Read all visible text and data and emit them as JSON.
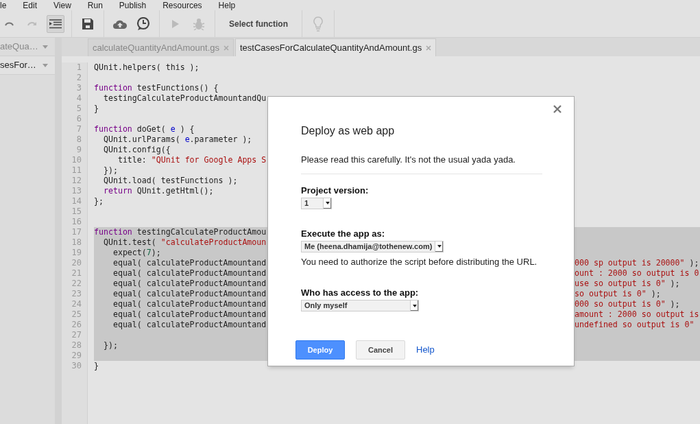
{
  "menu_bar": [
    "le",
    "Edit",
    "View",
    "Run",
    "Publish",
    "Resources",
    "Help"
  ],
  "toolbar": {
    "function_select": "Select function",
    "indent_pressed": true
  },
  "sidebar": {
    "files": [
      {
        "label": "ateQua…",
        "selected": false
      },
      {
        "label": "sesFor…",
        "selected": true
      }
    ]
  },
  "tabs": [
    {
      "label": "calculateQuantityAndAmount.gs",
      "selected": false
    },
    {
      "label": "testCasesForCalculateQuantityAndAmount.gs",
      "selected": true
    }
  ],
  "editor": {
    "lines": [
      {
        "number": "1",
        "selected": false,
        "left": [
          {
            "text": "QUnit.helpers( this );",
            "kind": "plain"
          }
        ]
      },
      {
        "number": "2",
        "selected": false
      },
      {
        "number": "3",
        "selected": false,
        "left": [
          {
            "text": "function",
            "kind": "keyword"
          },
          {
            "text": " testFunctions() {",
            "kind": "plain"
          }
        ]
      },
      {
        "number": "4",
        "selected": false,
        "left": [
          {
            "text": "  testingCalculateProductAmountandQu",
            "kind": "plain"
          }
        ]
      },
      {
        "number": "5",
        "selected": false,
        "left": [
          {
            "text": "}",
            "kind": "plain"
          }
        ]
      },
      {
        "number": "6",
        "selected": false
      },
      {
        "number": "7",
        "selected": false,
        "left": [
          {
            "text": "function",
            "kind": "keyword"
          },
          {
            "text": " doGet( ",
            "kind": "plain"
          },
          {
            "text": "e",
            "kind": "variable"
          },
          {
            "text": " ) {",
            "kind": "plain"
          }
        ]
      },
      {
        "number": "8",
        "selected": false,
        "left": [
          {
            "text": "  QUnit.urlParams( ",
            "kind": "plain"
          },
          {
            "text": "e",
            "kind": "variable"
          },
          {
            "text": ".parameter );",
            "kind": "plain"
          }
        ]
      },
      {
        "number": "9",
        "selected": false,
        "left": [
          {
            "text": "  QUnit.config({",
            "kind": "plain"
          }
        ]
      },
      {
        "number": "10",
        "selected": false,
        "left": [
          {
            "text": "     title: ",
            "kind": "plain"
          },
          {
            "text": "\"QUnit for Google Apps S",
            "kind": "string"
          }
        ]
      },
      {
        "number": "11",
        "selected": false,
        "left": [
          {
            "text": "  });",
            "kind": "plain"
          }
        ]
      },
      {
        "number": "12",
        "selected": false,
        "left": [
          {
            "text": "  QUnit.load( testFunctions );",
            "kind": "plain"
          }
        ]
      },
      {
        "number": "13",
        "selected": false,
        "left": [
          {
            "text": "  return",
            "kind": "keyword"
          },
          {
            "text": " QUnit.getHtml();",
            "kind": "plain"
          }
        ]
      },
      {
        "number": "14",
        "selected": false,
        "left": [
          {
            "text": "};",
            "kind": "plain"
          }
        ]
      },
      {
        "number": "15",
        "selected": false
      },
      {
        "number": "16",
        "selected": false
      },
      {
        "number": "17",
        "selected": true,
        "left": [
          {
            "text": "function",
            "kind": "keyword"
          },
          {
            "text": " testingCalculateProductAmou",
            "kind": "plain"
          }
        ]
      },
      {
        "number": "18",
        "selected": true,
        "left": [
          {
            "text": "  QUnit.test( ",
            "kind": "plain"
          },
          {
            "text": "\"calculateProductAmoun",
            "kind": "string"
          }
        ]
      },
      {
        "number": "19",
        "selected": true,
        "left": [
          {
            "text": "    expect(",
            "kind": "plain"
          },
          {
            "text": "7",
            "kind": "number"
          },
          {
            "text": ");",
            "kind": "plain"
          }
        ]
      },
      {
        "number": "20",
        "selected": true,
        "left": [
          {
            "text": "    equal( calculateProductAmountand",
            "kind": "plain"
          }
        ],
        "right": [
          {
            "text": "000 sp output is 20000\"",
            "kind": "string"
          },
          {
            "text": " );",
            "kind": "plain"
          }
        ]
      },
      {
        "number": "21",
        "selected": true,
        "left": [
          {
            "text": "    equal( calculateProductAmountand",
            "kind": "plain"
          }
        ],
        "right": [
          {
            "text": "ount : 2000 so output is 0",
            "kind": "string"
          }
        ]
      },
      {
        "number": "22",
        "selected": true,
        "left": [
          {
            "text": "    equal( calculateProductAmountand",
            "kind": "plain"
          }
        ],
        "right": [
          {
            "text": "use so output is 0\"",
            "kind": "string"
          },
          {
            "text": " );",
            "kind": "plain"
          }
        ]
      },
      {
        "number": "23",
        "selected": true,
        "left": [
          {
            "text": "    equal( calculateProductAmountand",
            "kind": "plain"
          }
        ],
        "right": [
          {
            "text": "so output is 0\"",
            "kind": "string"
          },
          {
            "text": " );",
            "kind": "plain"
          }
        ]
      },
      {
        "number": "24",
        "selected": true,
        "left": [
          {
            "text": "    equal( calculateProductAmountand",
            "kind": "plain"
          }
        ],
        "right": [
          {
            "text": "000 so output is 0\"",
            "kind": "string"
          },
          {
            "text": " );",
            "kind": "plain"
          }
        ]
      },
      {
        "number": "25",
        "selected": true,
        "left": [
          {
            "text": "    equal( calculateProductAmountand",
            "kind": "plain"
          }
        ],
        "right": [
          {
            "text": "amount : 2000 so output is",
            "kind": "string"
          }
        ]
      },
      {
        "number": "26",
        "selected": true,
        "left": [
          {
            "text": "    equal( calculateProductAmountand",
            "kind": "plain"
          }
        ],
        "right": [
          {
            "text": "undefined so output is 0\"",
            "kind": "string"
          }
        ]
      },
      {
        "number": "27",
        "selected": true
      },
      {
        "number": "28",
        "selected": true,
        "left": [
          {
            "text": "  });",
            "kind": "plain"
          }
        ]
      },
      {
        "number": "29",
        "selected": true
      },
      {
        "number": "30",
        "selected": false,
        "left": [
          {
            "text": "}",
            "kind": "plain"
          }
        ]
      }
    ]
  },
  "dialog": {
    "title": "Deploy as web app",
    "intro": "Please read this carefully. It's not the usual yada yada.",
    "fields": [
      {
        "label": "Project version:",
        "value": "1",
        "kind": "short"
      },
      {
        "label": "Execute the app as:",
        "value": "Me (heena.dhamija@tothenew.com)",
        "kind": "medium",
        "note": "You need to authorize the script before distributing the URL."
      },
      {
        "label": "Who has access to the app:",
        "value": "Only myself",
        "kind": "long"
      }
    ],
    "buttons": [
      {
        "label": "Deploy",
        "kind": "primary"
      },
      {
        "label": "Cancel",
        "kind": "secondary"
      },
      {
        "label": "Help",
        "kind": "link"
      }
    ]
  }
}
